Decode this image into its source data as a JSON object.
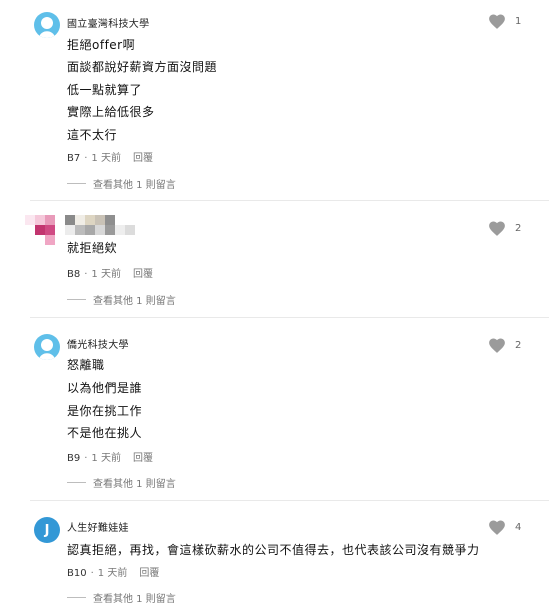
{
  "comments": [
    {
      "author": "國立臺灣科技大學",
      "lines": [
        "拒絕offer啊",
        "面談都說好薪資方面沒問題",
        "低一點就算了",
        "實際上給低很多",
        "這不太行"
      ],
      "floor": "B7",
      "time": "1 天前",
      "reply": "回覆",
      "more": "查看其他 1 則留言",
      "likes": "1"
    },
    {
      "author": "",
      "lines": [
        "就拒絕欸"
      ],
      "floor": "B8",
      "time": "1 天前",
      "reply": "回覆",
      "more": "查看其他 1 則留言",
      "likes": "2"
    },
    {
      "author": "僑光科技大學",
      "lines": [
        "怒離職",
        "以為他們是誰",
        "是你在挑工作",
        "不是他在挑人"
      ],
      "floor": "B9",
      "time": "1 天前",
      "reply": "回覆",
      "more": "查看其他 1 則留言",
      "likes": "2"
    },
    {
      "author": "人生好難娃娃",
      "avatar_letter": "J",
      "lines": [
        "認真拒絕，再找，會這樣砍薪水的公司不值得去，也代表該公司沒有競爭力"
      ],
      "floor": "B10",
      "time": "1 天前",
      "reply": "回覆",
      "more": "查看其他 1 則留言",
      "likes": "4"
    }
  ],
  "colors": {
    "anon_avatar": "#5fbfe9",
    "letter_avatar": "#3398d6",
    "heart": "#9b9b9b",
    "meta_text": "#777777",
    "divider": "#e9e9e9"
  },
  "icons": {
    "like": "heart-icon",
    "anon_avatar": "anonymous-avatar-icon"
  }
}
